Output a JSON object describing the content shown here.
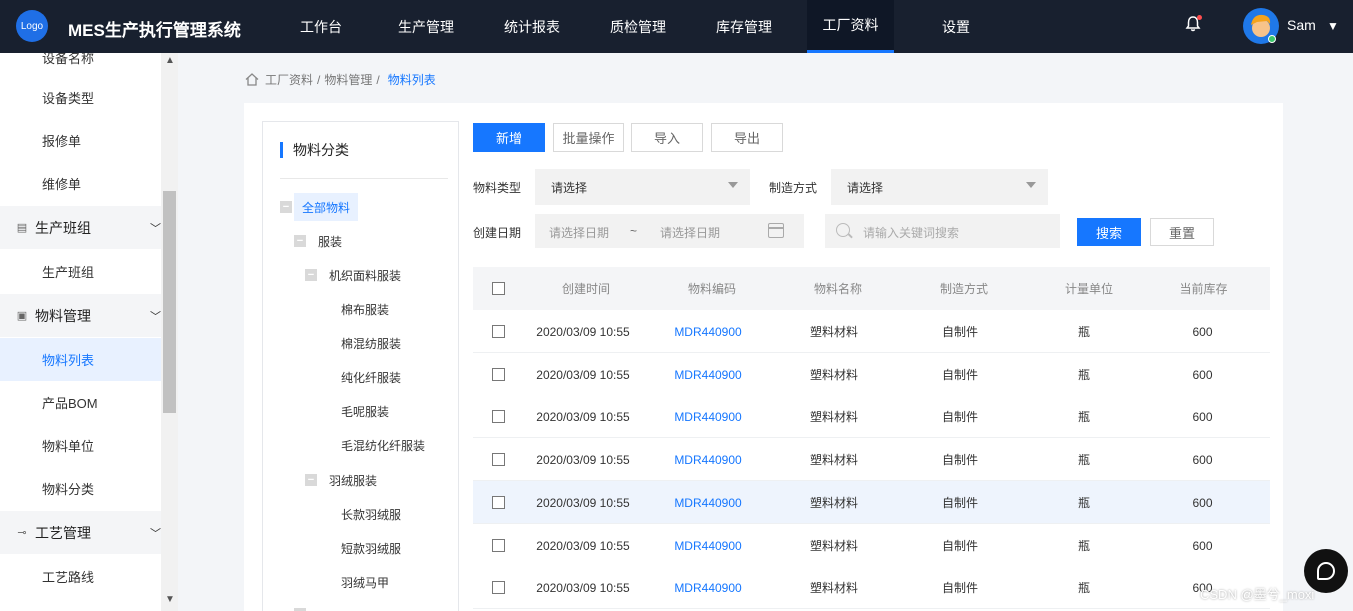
{
  "header": {
    "logo_text": "Logo",
    "app_title": "MES生产执行管理系统",
    "nav": [
      "工作台",
      "生产管理",
      "统计报表",
      "质检管理",
      "库存管理",
      "工厂资料",
      "设置"
    ],
    "active_nav": "工厂资料",
    "user_name": "Sam"
  },
  "sidebar": {
    "items": [
      {
        "label": "设备名称",
        "type": "sub"
      },
      {
        "label": "设备类型",
        "type": "sub"
      },
      {
        "label": "报修单",
        "type": "sub"
      },
      {
        "label": "维修单",
        "type": "sub"
      },
      {
        "label": "生产班组",
        "type": "group"
      },
      {
        "label": "生产班组",
        "type": "sub"
      },
      {
        "label": "物料管理",
        "type": "group"
      },
      {
        "label": "物料列表",
        "type": "sub",
        "active": true
      },
      {
        "label": "产品BOM",
        "type": "sub"
      },
      {
        "label": "物料单位",
        "type": "sub"
      },
      {
        "label": "物料分类",
        "type": "sub"
      },
      {
        "label": "工艺管理",
        "type": "group"
      },
      {
        "label": "工艺路线",
        "type": "sub"
      }
    ]
  },
  "breadcrumb": {
    "items": [
      "工厂资料",
      "物料管理"
    ],
    "current": "物料列表"
  },
  "tree": {
    "title": "物料分类",
    "nodes": [
      {
        "label": "全部物料",
        "level": 0,
        "selected": true
      },
      {
        "label": "服装",
        "level": 1
      },
      {
        "label": "机织面料服装",
        "level": 2
      },
      {
        "label": "棉布服装",
        "level": 3
      },
      {
        "label": "棉混纺服装",
        "level": 3
      },
      {
        "label": "纯化纤服装",
        "level": 3
      },
      {
        "label": "毛呢服装",
        "level": 3
      },
      {
        "label": "毛混纺化纤服装",
        "level": 3
      },
      {
        "label": "羽绒服装",
        "level": 2
      },
      {
        "label": "长款羽绒服",
        "level": 3
      },
      {
        "label": "短款羽绒服",
        "level": 3
      },
      {
        "label": "羽绒马甲",
        "level": 3
      }
    ]
  },
  "toolbar": {
    "add": "新增",
    "batch": "批量操作",
    "import": "导入",
    "export": "导出"
  },
  "filters": {
    "material_type_label": "物料类型",
    "material_type_value": "请选择",
    "manufacture_label": "制造方式",
    "manufacture_value": "请选择",
    "date_label": "创建日期",
    "date_start_placeholder": "请选择日期",
    "date_sep": "~",
    "date_end_placeholder": "请选择日期",
    "keyword_placeholder": "请输入关键词搜索",
    "search": "搜索",
    "reset": "重置"
  },
  "table": {
    "columns": [
      "创建时间",
      "物料编码",
      "物料名称",
      "制造方式",
      "计量单位",
      "当前库存"
    ],
    "rows": [
      [
        "2020/03/09 10:55",
        "MDR440900",
        "塑料材料",
        "自制件",
        "瓶",
        "600"
      ],
      [
        "2020/03/09 10:55",
        "MDR440900",
        "塑料材料",
        "自制件",
        "瓶",
        "600"
      ],
      [
        "2020/03/09 10:55",
        "MDR440900",
        "塑料材料",
        "自制件",
        "瓶",
        "600"
      ],
      [
        "2020/03/09 10:55",
        "MDR440900",
        "塑料材料",
        "自制件",
        "瓶",
        "600"
      ],
      [
        "2020/03/09 10:55",
        "MDR440900",
        "塑料材料",
        "自制件",
        "瓶",
        "600"
      ],
      [
        "2020/03/09 10:55",
        "MDR440900",
        "塑料材料",
        "自制件",
        "瓶",
        "600"
      ],
      [
        "2020/03/09 10:55",
        "MDR440900",
        "塑料材料",
        "自制件",
        "瓶",
        "600"
      ]
    ],
    "highlighted_row": 4
  },
  "watermark": "CSDN @墨兮_moxi",
  "colors": {
    "header_bg": "#18202f",
    "accent": "#1677ff",
    "panel_bg": "#ffffff",
    "page_bg": "#f3f5f8"
  }
}
